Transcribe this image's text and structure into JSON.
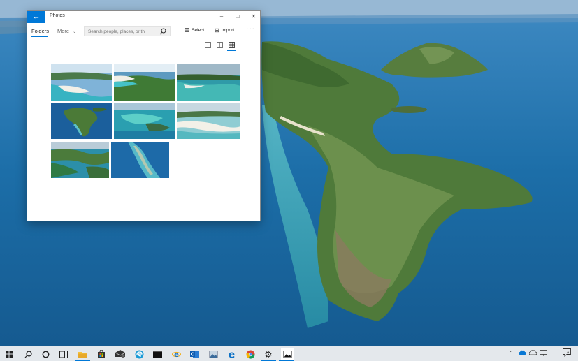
{
  "window": {
    "title": "Photos",
    "back_icon": "back-arrow-icon",
    "controls": {
      "minimize": "–",
      "maximize": "□",
      "close": "✕"
    }
  },
  "toolbar": {
    "tab_folders": "Folders",
    "tab_more": "More",
    "search_placeholder": "Search people, places, or th",
    "select_label": "Select",
    "import_label": "Import",
    "more_options": "···"
  },
  "view_modes": [
    "single-square-icon",
    "four-grid-icon",
    "nine-grid-icon"
  ],
  "active_view": "nine-grid-icon",
  "photos": [
    {
      "id": "whitehaven-beach-1"
    },
    {
      "id": "whitehaven-beach-2"
    },
    {
      "id": "coastline-reef"
    },
    {
      "id": "island-peninsula"
    },
    {
      "id": "turquoise-lagoon"
    },
    {
      "id": "sand-swirls"
    },
    {
      "id": "island-bay"
    },
    {
      "id": "reef-shallows"
    }
  ],
  "taskbar": {
    "items": [
      "windows-start-icon",
      "search-icon",
      "cortana-icon",
      "task-view-icon",
      "file-explorer-icon",
      "store-icon",
      "mail-icon",
      "edge-beta-icon",
      "terminal-icon",
      "ie-icon",
      "outlook-icon",
      "photos-app-icon",
      "edge-icon",
      "chrome-icon",
      "settings-icon",
      "photos-running-icon"
    ],
    "notification_count": "2"
  },
  "colors": {
    "accent": "#0078d7",
    "taskbar_bg": "#e4e8ec"
  }
}
